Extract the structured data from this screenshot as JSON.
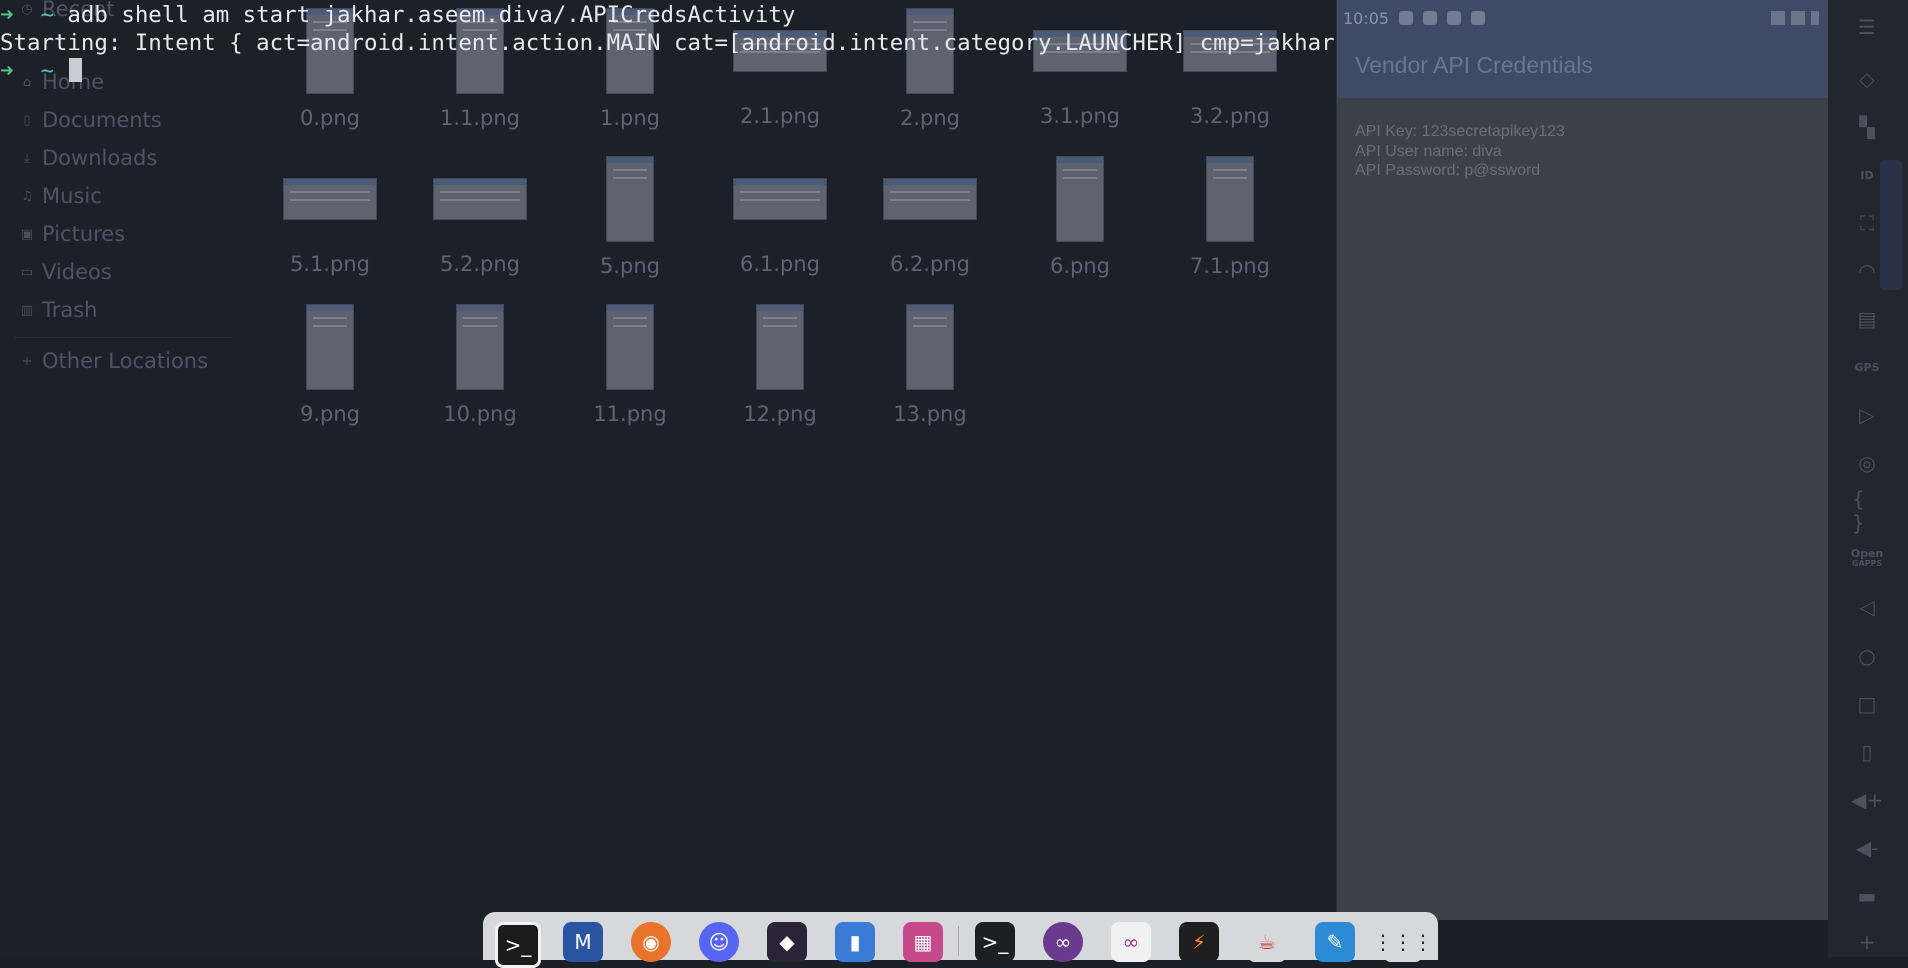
{
  "terminal": {
    "prompt_arrow": "➜",
    "prompt_dir": "~",
    "command": "adb shell am start jakhar.aseem.diva/.APICredsActivity",
    "output": "Starting: Intent { act=android.intent.action.MAIN cat=[android.intent.category.LAUNCHER] cmp=jakhar.aseem.diva/.APICredsActivity }"
  },
  "file_manager": {
    "sidebar": {
      "items": [
        {
          "label": "Recent",
          "icon": "clock-icon"
        },
        {
          "label": "Home",
          "icon": "home-icon"
        },
        {
          "label": "Documents",
          "icon": "document-icon"
        },
        {
          "label": "Downloads",
          "icon": "download-icon"
        },
        {
          "label": "Music",
          "icon": "music-icon"
        },
        {
          "label": "Pictures",
          "icon": "picture-icon"
        },
        {
          "label": "Videos",
          "icon": "video-icon"
        },
        {
          "label": "Trash",
          "icon": "trash-icon"
        }
      ],
      "other_locations": "Other Locations"
    },
    "files": [
      "0.png",
      "1.1.png",
      "1.png",
      "2.1.png",
      "2.png",
      "3.1.png",
      "3.2.png",
      "5.1.png",
      "5.2.png",
      "5.png",
      "6.1.png",
      "6.2.png",
      "6.png",
      "7.1.png",
      "9.png",
      "10.png",
      "11.png",
      "12.png",
      "13.png"
    ]
  },
  "emulator": {
    "status_time": "10:05",
    "title": "Vendor API Credentials",
    "api_key_line": "API Key: 123secretapikey123",
    "api_user_line": "API User name: diva",
    "api_password_line": "API Password: p@ssword"
  },
  "emulator_toolbar": {
    "icons": [
      "menu-icon",
      "eraser-icon",
      "camera-icon",
      "id-icon",
      "fullscreen-icon",
      "rss-icon",
      "sd-card-icon",
      "gps-icon",
      "media-icon",
      "disk-icon",
      "braces-icon",
      "opengapps-icon",
      "back-icon",
      "home-circle-icon",
      "recents-square-icon",
      "phone-icon",
      "volume-up-icon",
      "volume-down-icon",
      "keyboard-icon",
      "plus-icon"
    ],
    "gps_label": "GPS",
    "open_label": "Open",
    "gapps_label": "GAPPS"
  },
  "dock": {
    "apps": [
      "terminal-app-icon",
      "metasploit-icon",
      "firefox-icon",
      "discord-icon",
      "obsidian-icon",
      "file-manager-icon",
      "image-viewer-icon",
      "console-icon",
      "burp-icon",
      "genymotion-icon",
      "sublime-icon",
      "java-icon",
      "text-editor-icon",
      "app-grid-icon"
    ]
  },
  "colors": {
    "accent_red": "#a1232b",
    "prompt_green": "#4fc08d",
    "emulator_appbar": "#3f4a66"
  }
}
